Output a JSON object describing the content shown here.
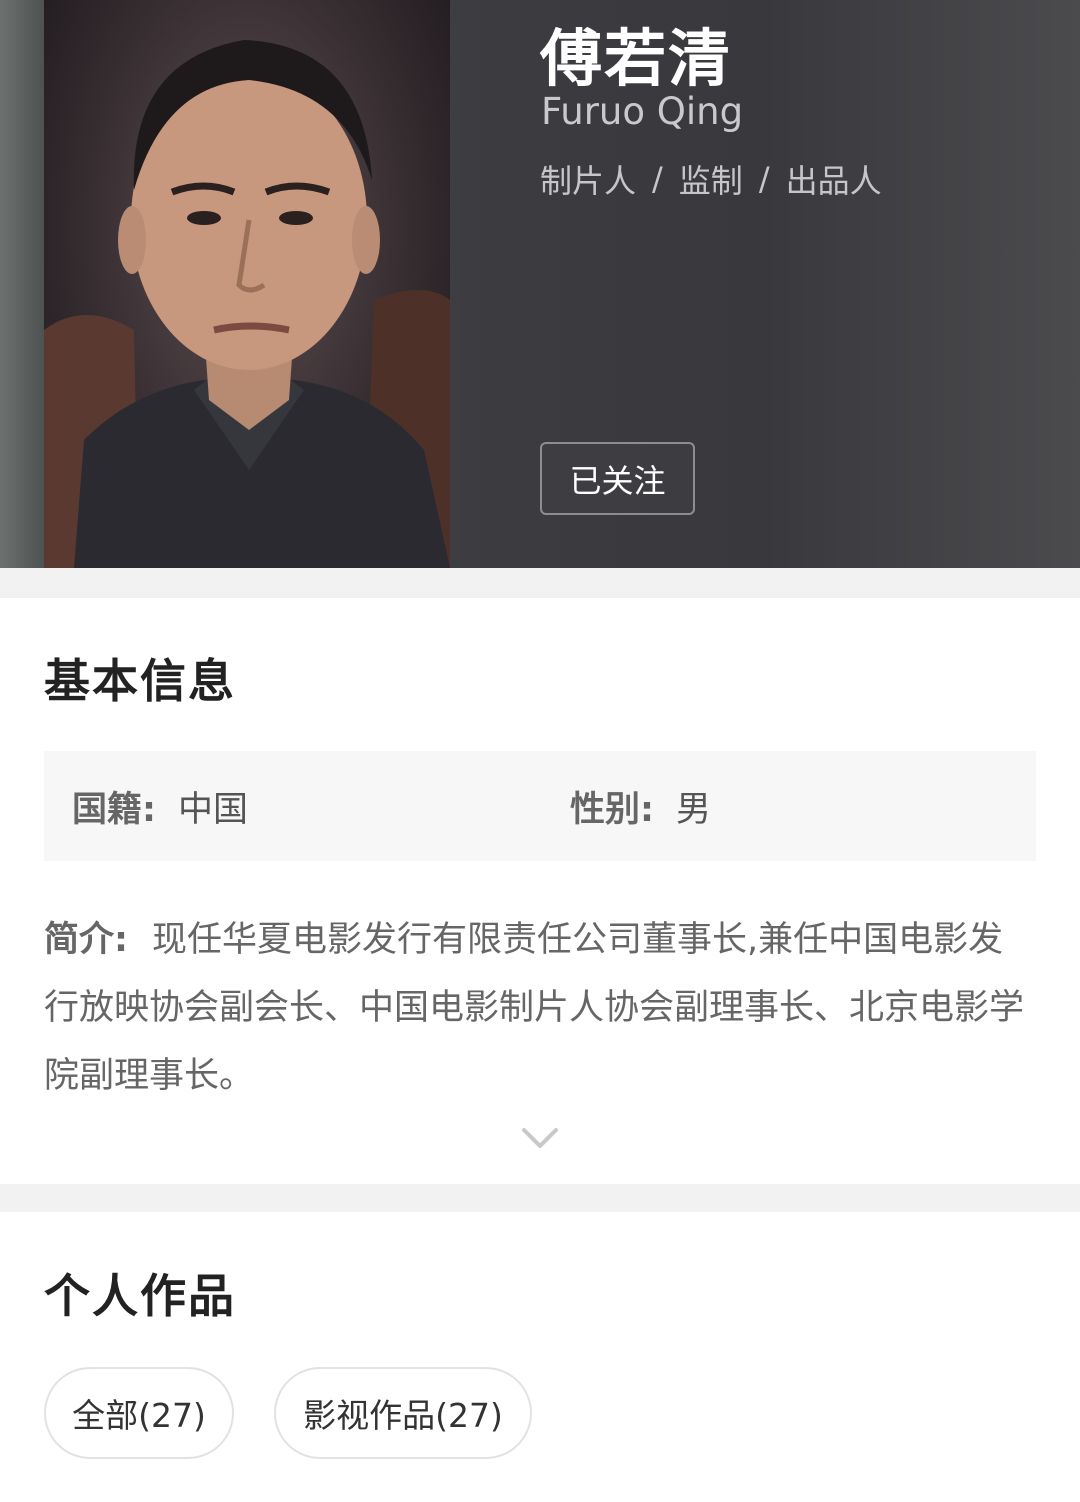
{
  "person": {
    "name": "傅若清",
    "name_en": "Furuo Qing",
    "roles": [
      "制片人",
      "监制",
      "出品人"
    ],
    "role_separator": "/",
    "follow_label": "已关注"
  },
  "basic_info": {
    "title": "基本信息",
    "nationality_label": "国籍:",
    "nationality_value": "中国",
    "gender_label": "性别:",
    "gender_value": "男",
    "intro_label": "简介:",
    "intro_text": "现任华夏电影发行有限责任公司董事长,兼任中国电影发行放映协会副会长、中国电影制片人协会副理事长、北京电影学院副理事长。"
  },
  "works": {
    "title": "个人作品",
    "filters": [
      {
        "label": "全部(27)"
      },
      {
        "label": "影视作品(27)"
      }
    ]
  },
  "icons": {
    "expand": "chevron-down-icon"
  },
  "colors": {
    "hero_bg": "#3c3c40",
    "section_gap": "#f2f2f2",
    "info_box_bg": "#f7f7f7"
  }
}
